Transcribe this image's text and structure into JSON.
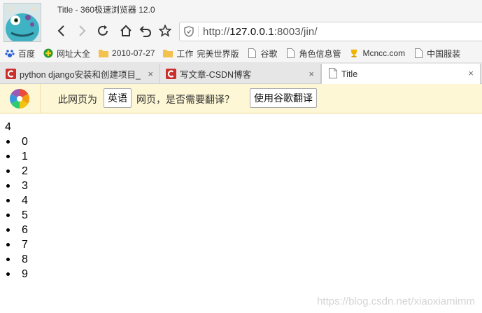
{
  "window": {
    "title": "Title - 360极速浏览器 12.0"
  },
  "address_bar": {
    "scheme": "http://",
    "host": "127.0.0.1",
    "rest": ":8003/jin/"
  },
  "bookmarks": [
    {
      "label": "百度",
      "icon": "paw-icon"
    },
    {
      "label": "网址大全",
      "icon": "globe-plus-icon"
    },
    {
      "label": "2010-07-27",
      "icon": "folder-icon"
    },
    {
      "label": "工作",
      "icon": "folder-icon"
    },
    {
      "label": "完美世界版",
      "icon": "page-icon"
    },
    {
      "label": "谷歌",
      "icon": "page-icon"
    },
    {
      "label": "角色信息管",
      "icon": "page-icon"
    },
    {
      "label": "Mcncc.com",
      "icon": "trophy-icon"
    },
    {
      "label": "中国服装",
      "icon": "page-icon"
    }
  ],
  "tabs": [
    {
      "label": "python django安装和创建项目_",
      "icon": "csdn-icon",
      "close": "×"
    },
    {
      "label": "写文章-CSDN博客",
      "icon": "csdn-icon",
      "close": "×"
    },
    {
      "label": "Title",
      "icon": "page-icon",
      "close": "×"
    }
  ],
  "translate_bar": {
    "prefix": "此网页为",
    "language": "英语",
    "suffix": "网页，是否需要翻译？",
    "translate_button": "使用谷歌翻译"
  },
  "page": {
    "heading_value": "4",
    "list": [
      "0",
      "1",
      "2",
      "3",
      "4",
      "5",
      "6",
      "7",
      "8",
      "9"
    ]
  },
  "watermark": "https://blog.csdn.net/xiaoxiamimm",
  "colors": {
    "translate_bg": "#fdf7d5",
    "csdn_red": "#c9302c",
    "toolbar_bg": "#f5f5f5"
  }
}
